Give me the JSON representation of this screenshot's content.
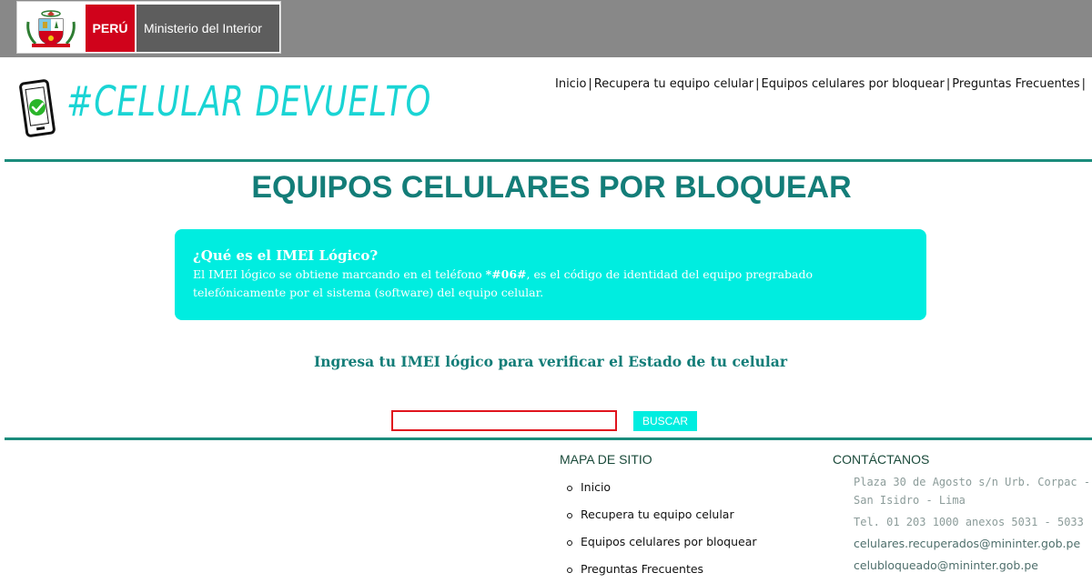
{
  "gov_bar": {
    "country_label": "PERÚ",
    "ministry_label": "Ministerio del Interior",
    "colors": {
      "bar": "#888888",
      "country": "#d0021b",
      "ministry": "#5d5d5d"
    }
  },
  "brand": {
    "name": "#CELULAR DEVUELTO",
    "icon": "smartphone-check-icon",
    "color": "#1ad4d4"
  },
  "nav": {
    "items": [
      {
        "label": "Inicio"
      },
      {
        "label": "Recupera tu equipo celular"
      },
      {
        "label": "Equipos celulares por bloquear"
      },
      {
        "label": "Preguntas Frecuentes"
      }
    ],
    "separator": "|"
  },
  "page": {
    "title": "EQUIPOS CELULARES POR BLOQUEAR",
    "title_color": "#137d78"
  },
  "info": {
    "title": "¿Qué es el IMEI Lógico?",
    "text_before": "El IMEI lógico se obtiene marcando en el teléfono ",
    "code": "*#06#",
    "text_after": ", es el código de identidad del equipo pregrabado telefónicamente por el sistema (software) del equipo celular.",
    "bg_color": "#00ede0"
  },
  "search": {
    "prompt": "Ingresa tu IMEI lógico para verificar el Estado de tu celular",
    "input_value": "",
    "input_placeholder": "",
    "button_label": "BUSCAR"
  },
  "footer": {
    "sitemap": {
      "heading": "MAPA DE SITIO",
      "items": [
        {
          "label": "Inicio"
        },
        {
          "label": "Recupera tu equipo celular"
        },
        {
          "label": "Equipos celulares por bloquear"
        },
        {
          "label": "Preguntas Frecuentes"
        }
      ]
    },
    "contact": {
      "heading": "CONTÁCTANOS",
      "address": "Plaza 30 de Agosto s/n Urb. Corpac - San Isidro - Lima",
      "phone": "Tel. 01 203 1000 anexos 5031 - 5033",
      "email1": "celulares.recuperados@mininter.gob.pe",
      "email2": "celubloqueado@mininter.gob.pe"
    }
  }
}
